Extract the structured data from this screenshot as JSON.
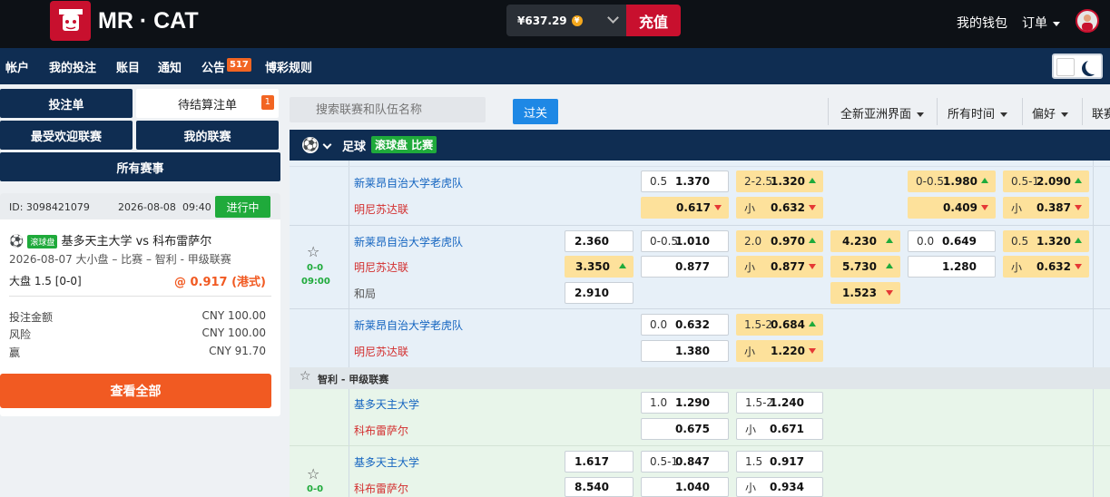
{
  "header": {
    "logo_text": "MR · CAT",
    "balance": "¥637.29",
    "deposit_label": "充值",
    "wallet_label": "我的钱包",
    "orders_label": "订单"
  },
  "nav": {
    "items": [
      "帐户",
      "我的投注",
      "账目",
      "通知",
      "公告",
      "博彩规则"
    ],
    "announcement_count": "517"
  },
  "left": {
    "betslip_tab": "投注单",
    "pending_tab": "待结算注单",
    "pending_count": "1",
    "popular_leagues": "最受欢迎联赛",
    "my_leagues": "我的联赛",
    "all_events": "所有赛事",
    "bet": {
      "id": "ID: 3098421079",
      "date": "2026-08-08",
      "time": "09:40",
      "status": "进行中",
      "live_tag": "滚球盘",
      "match": "基多天主大学 vs 科布雷萨尔",
      "detail": "2026-08-07 大小盘 – 比赛 – 智利 - 甲级联赛",
      "selection": "大盘 1.5 [0-0]",
      "odds": "@ 0.917 (港式)",
      "stake_label": "投注金额",
      "stake_value": "CNY 100.00",
      "risk_label": "风险",
      "risk_value": "CNY 100.00",
      "win_label": "赢",
      "win_value": "CNY 91.70"
    },
    "view_all": "查看全部"
  },
  "toolbar": {
    "search_placeholder": "搜索联赛和队伍名称",
    "filter_label": "过关",
    "dropdowns": [
      "全新亚洲界面",
      "所有时间",
      "偏好",
      "联赛"
    ]
  },
  "sport": {
    "name": "足球",
    "live_label": "滚球盘 比赛"
  },
  "match1": {
    "score": "0-0",
    "time": "09:00",
    "home": "新莱昂自治大学老虎队",
    "away": "明尼苏达联",
    "draw": "和局",
    "rows": [
      {
        "ah": [
          "0.5",
          "1.370",
          "",
          "0.617"
        ],
        "ou": [
          "2-2.5",
          "1.320",
          "小",
          "0.632"
        ],
        "ah1": [
          "0-0.5",
          "1.980",
          "",
          "0.409"
        ],
        "ou1": [
          "0.5-1",
          "2.090",
          "小",
          "0.387"
        ]
      },
      {
        "x12": [
          "2.360",
          "3.350",
          "2.910"
        ],
        "ah": [
          "0-0.5",
          "1.010",
          "",
          "0.877"
        ],
        "ou": [
          "2.0",
          "0.970",
          "小",
          "0.877"
        ],
        "x12h": [
          "4.230",
          "5.730",
          "1.523"
        ],
        "ah1": [
          "0.0",
          "0.649",
          "",
          "1.280"
        ],
        "ou1": [
          "0.5",
          "1.320",
          "小",
          "0.632"
        ]
      },
      {
        "ah": [
          "0.0",
          "0.632",
          "",
          "1.380"
        ],
        "ou": [
          "1.5-2",
          "0.684",
          "小",
          "1.220"
        ]
      }
    ]
  },
  "league2": {
    "name": "智利 - 甲级联赛",
    "score": "0-0",
    "home": "基多天主大学",
    "away": "科布雷萨尔",
    "rows": [
      {
        "ah": [
          "1.0",
          "1.290",
          "",
          "0.675"
        ],
        "ou": [
          "1.5-2",
          "1.240",
          "小",
          "0.671"
        ]
      },
      {
        "x12": [
          "1.617",
          "8.540"
        ],
        "ah": [
          "0.5-1",
          "0.847",
          "",
          "1.040"
        ],
        "ou": [
          "1.5",
          "0.917",
          "小",
          "0.934"
        ]
      }
    ]
  },
  "colors": {
    "navy": "#0f2d52",
    "brand_red": "#c8102e",
    "live_green": "#1faa3b",
    "odds_yellow": "#fde19b"
  }
}
